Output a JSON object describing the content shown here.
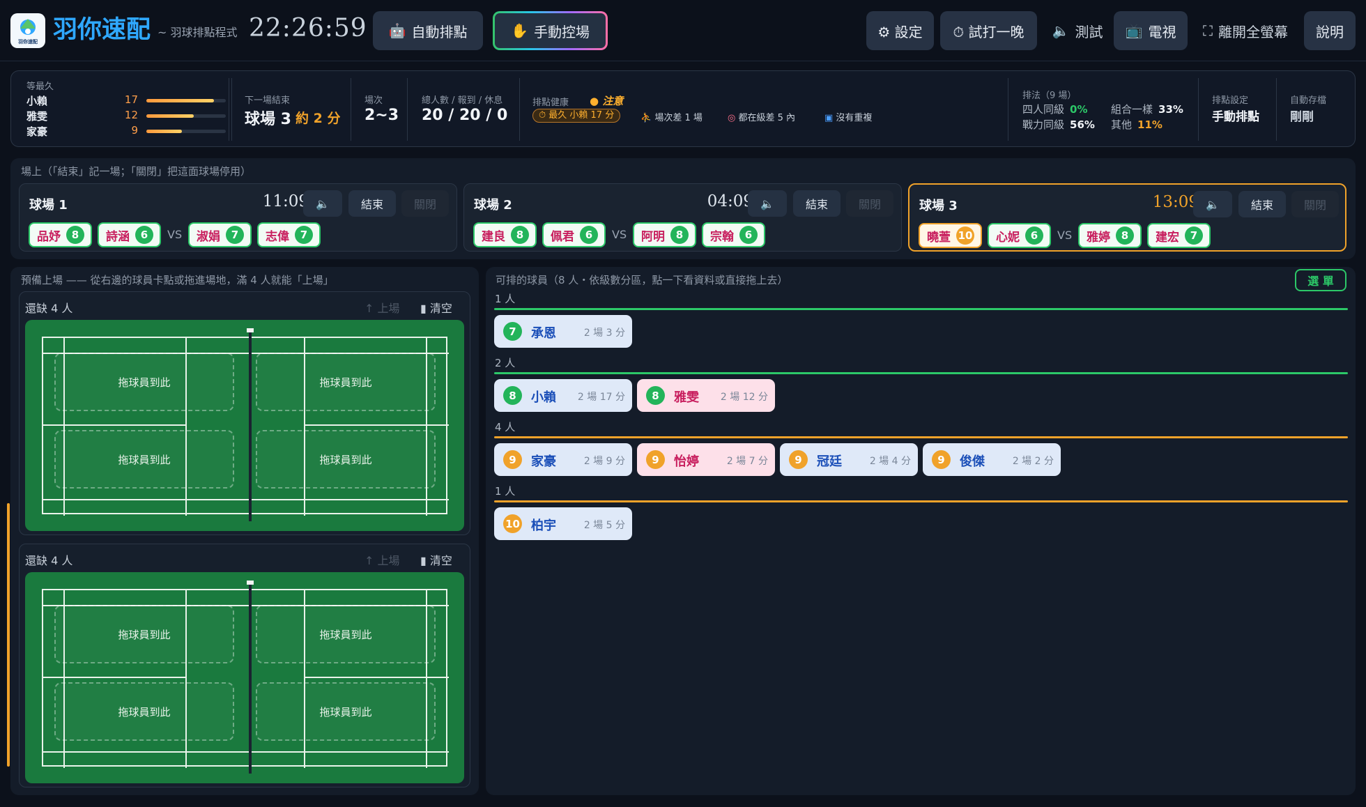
{
  "app": {
    "logo_text": "羽你速配",
    "name": "羽你速配",
    "subtitle": "~ 羽球排點程式",
    "clock": "22:26:59"
  },
  "toolbar": {
    "auto": "自動排點",
    "manual": "手動控場",
    "settings": "⚙ 設定",
    "trial": "⏱ 試打一晚",
    "test": "測試",
    "tv": "電視",
    "fullscreen": "離開全螢幕",
    "help": "說明"
  },
  "stats": {
    "wait_label": "等最久",
    "waiting": [
      {
        "name": "小賴",
        "minutes": "17",
        "level": 0.85
      },
      {
        "name": "雅雯",
        "minutes": "12",
        "level": 0.6
      },
      {
        "name": "家豪",
        "minutes": "9",
        "level": 0.45
      }
    ],
    "next_end_label": "下一場結束",
    "next_court": "球場 3",
    "next_eta": "約 2 分",
    "rounds_label": "場次",
    "rounds": "2~3",
    "people_label": "總人數 / 報到 / 休息",
    "people": "20 / 20 / 0",
    "health_label": "排點健康",
    "health_status": "注意",
    "health_pill": "⏱ 最久 小賴 17 分",
    "health_items": [
      "場次差 1 場",
      "都在級差 5 內",
      "沒有重複"
    ],
    "method_label": "排法（9 場）",
    "method": [
      {
        "name": "四人同級",
        "pct": "0%",
        "color": "#2cc868"
      },
      {
        "name": "組合一樣",
        "pct": "33%",
        "color": "#f1f4f8"
      },
      {
        "name": "戰力同級",
        "pct": "56%",
        "color": "#f1f4f8"
      },
      {
        "name": "其他",
        "pct": "11%",
        "color": "#f0a22a"
      }
    ],
    "setting_label": "排點設定",
    "setting_value": "手動排點",
    "autosave_label": "自動存檔",
    "autosave_value": "剛剛"
  },
  "courts_section": {
    "title": "場上（「結束」記一場；「關閉」把這面球場停用）",
    "end_label": "結束",
    "close_label": "關閉",
    "vs": "VS",
    "courts": [
      {
        "name": "球場 1",
        "time": "11:09",
        "players": [
          {
            "name": "品妤",
            "level": "8"
          },
          {
            "name": "詩涵",
            "level": "6"
          },
          {
            "name": "淑娟",
            "level": "7"
          },
          {
            "name": "志偉",
            "level": "7"
          }
        ]
      },
      {
        "name": "球場 2",
        "time": "04:09",
        "players": [
          {
            "name": "建良",
            "level": "8"
          },
          {
            "name": "佩君",
            "level": "6"
          },
          {
            "name": "阿明",
            "level": "8"
          },
          {
            "name": "宗翰",
            "level": "6"
          }
        ]
      },
      {
        "name": "球場 3",
        "time": "13:09",
        "players": [
          {
            "name": "曉萱",
            "level": "10"
          },
          {
            "name": "心妮",
            "level": "6"
          },
          {
            "name": "雅婷",
            "level": "8"
          },
          {
            "name": "建宏",
            "level": "7"
          }
        ]
      }
    ]
  },
  "prepare": {
    "title": "預備上場 —— 從右邊的球員卡點或拖進場地，滿 4 人就能「上場」",
    "missing": "還缺 4 人",
    "up": "↑ 上場",
    "clear": "▮ 清空",
    "drop_hint": "拖球員到此"
  },
  "roster": {
    "title": "可排的球員（8 人・依級數分區，點一下看資料或直接拖上去）",
    "menu": "選 單",
    "groups": [
      {
        "label": "1 人",
        "color": "#2cc868",
        "players": [
          {
            "name": "承恩",
            "level": "7",
            "meta": "2 場  3 分",
            "pink": false
          }
        ]
      },
      {
        "label": "2 人",
        "color": "#2cc868",
        "players": [
          {
            "name": "小賴",
            "level": "8",
            "meta": "2 場  17 分",
            "pink": false
          },
          {
            "name": "雅雯",
            "level": "8",
            "meta": "2 場  12 分",
            "pink": true
          }
        ]
      },
      {
        "label": "4 人",
        "color": "#f0a22a",
        "players": [
          {
            "name": "家豪",
            "level": "9",
            "meta": "2 場  9 分",
            "pink": false
          },
          {
            "name": "怡婷",
            "level": "9",
            "meta": "2 場  7 分",
            "pink": true
          },
          {
            "name": "冠廷",
            "level": "9",
            "meta": "2 場  4 分",
            "pink": false
          },
          {
            "name": "俊傑",
            "level": "9",
            "meta": "2 場  2 分",
            "pink": false
          }
        ]
      },
      {
        "label": "1 人",
        "color": "#f0a22a",
        "players": [
          {
            "name": "柏宇",
            "level": "10",
            "meta": "2 場  5 分",
            "pink": false
          }
        ]
      }
    ]
  }
}
